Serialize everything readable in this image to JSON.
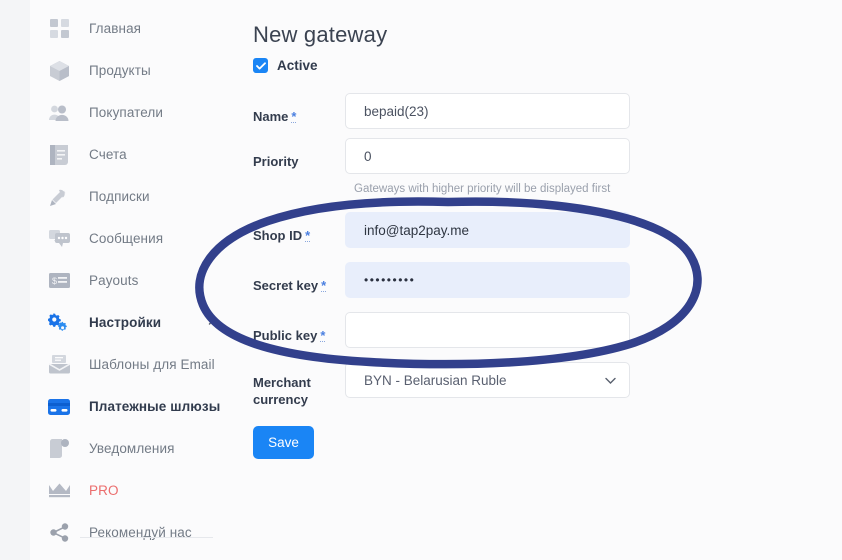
{
  "sidebar": {
    "items": [
      {
        "label": "Главная",
        "icon": "grid-icon",
        "active": false
      },
      {
        "label": "Продукты",
        "icon": "cube-icon",
        "active": false
      },
      {
        "label": "Покупатели",
        "icon": "users-icon",
        "active": false
      },
      {
        "label": "Счета",
        "icon": "invoice-icon",
        "active": false
      },
      {
        "label": "Подписки",
        "icon": "subscription-icon",
        "active": false
      },
      {
        "label": "Сообщения",
        "icon": "chat-icon",
        "active": false
      },
      {
        "label": "Payouts",
        "icon": "payout-icon",
        "active": false
      },
      {
        "label": "Настройки",
        "icon": "gears-icon",
        "active": true
      },
      {
        "label": "Шаблоны для Email",
        "icon": "mail-template-icon",
        "active": false
      },
      {
        "label": "Платежные шлюзы",
        "icon": "credit-card-icon",
        "active": true
      },
      {
        "label": "Уведомления",
        "icon": "notification-icon",
        "active": false
      },
      {
        "label": "PRO",
        "icon": "crown-icon",
        "active": false
      },
      {
        "label": "Рекомендуй нас",
        "icon": "share-icon",
        "active": false
      }
    ]
  },
  "form": {
    "title": "New gateway",
    "active_label": "Active",
    "active_checked": true,
    "fields": {
      "name": {
        "label": "Name",
        "required": "*",
        "value": "bepaid(23)"
      },
      "priority": {
        "label": "Priority",
        "required": "",
        "value": "0",
        "help": "Gateways with higher priority will be displayed first"
      },
      "shop_id": {
        "label": "Shop ID",
        "required": "*",
        "value": "info@tap2pay.me"
      },
      "secret_key": {
        "label": "Secret key",
        "required": "*",
        "value": "•••••••••"
      },
      "public_key": {
        "label": "Public key",
        "required": "*",
        "value": ""
      },
      "merchant_currency": {
        "label": "Merchant currency",
        "required": "",
        "value": "BYN - Belarusian Ruble"
      }
    },
    "save_label": "Save"
  },
  "annotation": {
    "shape": "ellipse-highlight",
    "color": "#32408c"
  }
}
